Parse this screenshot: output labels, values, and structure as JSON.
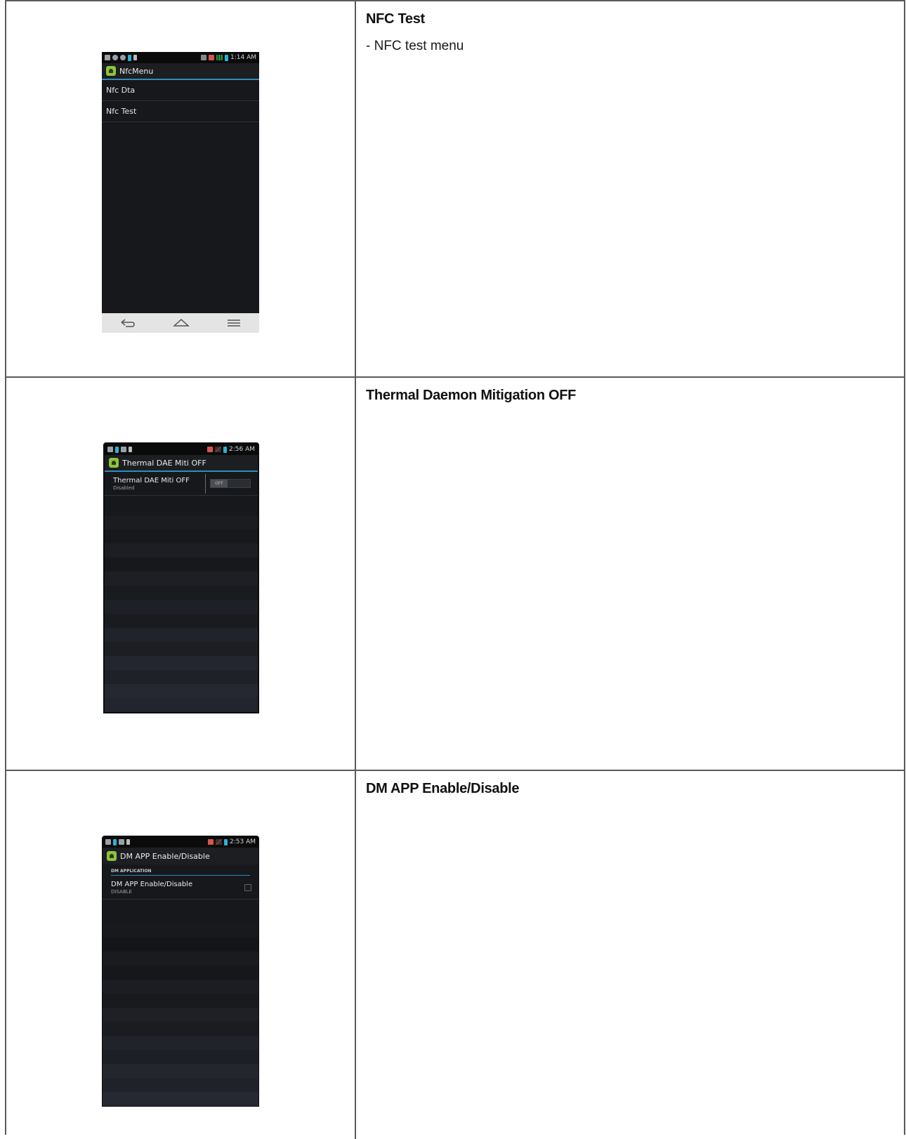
{
  "sections": [
    {
      "title": "NFC Test",
      "description": "- NFC test menu",
      "phone": {
        "status_time": "1:14 AM",
        "app_title": "NfcMenu",
        "items": [
          "Nfc Dta",
          "Nfc Test"
        ],
        "nav_icons": [
          "back-icon",
          "home-icon",
          "menu-icon"
        ]
      }
    },
    {
      "title": "Thermal Daemon Mitigation OFF",
      "description": "",
      "phone": {
        "status_time": "2:56 AM",
        "app_title": "Thermal DAE Miti OFF",
        "setting_title": "Thermal DAE Miti OFF",
        "setting_summary": "Disabled",
        "toggle_label": "OFF"
      }
    },
    {
      "title": "DM APP Enable/Disable",
      "description": "",
      "phone": {
        "status_time": "2:53 AM",
        "app_title": "DM APP Enable/Disable",
        "category": "DM APPLICATION",
        "setting_title": "DM APP Enable/Disable",
        "setting_summary": "DISABLE",
        "checkbox_checked": false
      }
    }
  ],
  "colors": {
    "accent_line": "#2d8eb5",
    "battery": "#27b4d6",
    "android_green": "#8fc33a",
    "table_border": "#5a5a5a"
  }
}
